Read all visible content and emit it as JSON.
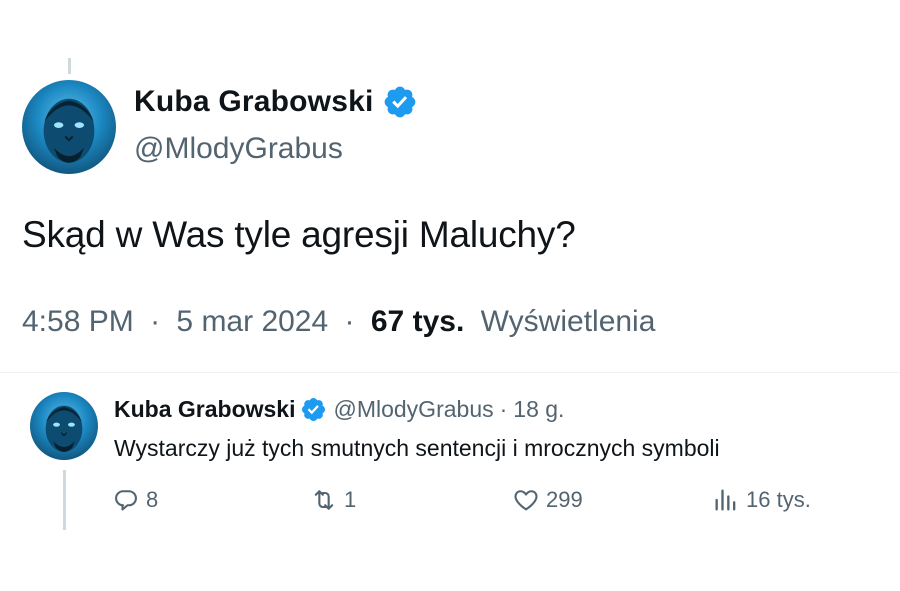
{
  "tweet": {
    "author_name": "Kuba Grabowski",
    "handle": "@MlodyGrabus",
    "text": "Skąd w Was tyle agresji Maluchy?",
    "time": "4:58 PM",
    "separator": "·",
    "date": "5 mar 2024",
    "views_count": "67 tys.",
    "views_label": "Wyświetlenia"
  },
  "reply": {
    "author_name": "Kuba Grabowski",
    "handle": "@MlodyGrabus",
    "separator": "·",
    "time_ago": "18 g.",
    "text": "Wystarczy już tych smutnych sentencji i mrocznych symboli",
    "replies": "8",
    "retweets": "1",
    "likes": "299",
    "views": "16 tys."
  },
  "colors": {
    "verified": "#1d9bf0",
    "secondary_text": "#536471",
    "primary_text": "#0f1419"
  },
  "icons": {
    "verified": "verified-badge-icon",
    "reply": "reply-icon",
    "retweet": "retweet-icon",
    "like": "heart-icon",
    "views": "views-chart-icon"
  }
}
